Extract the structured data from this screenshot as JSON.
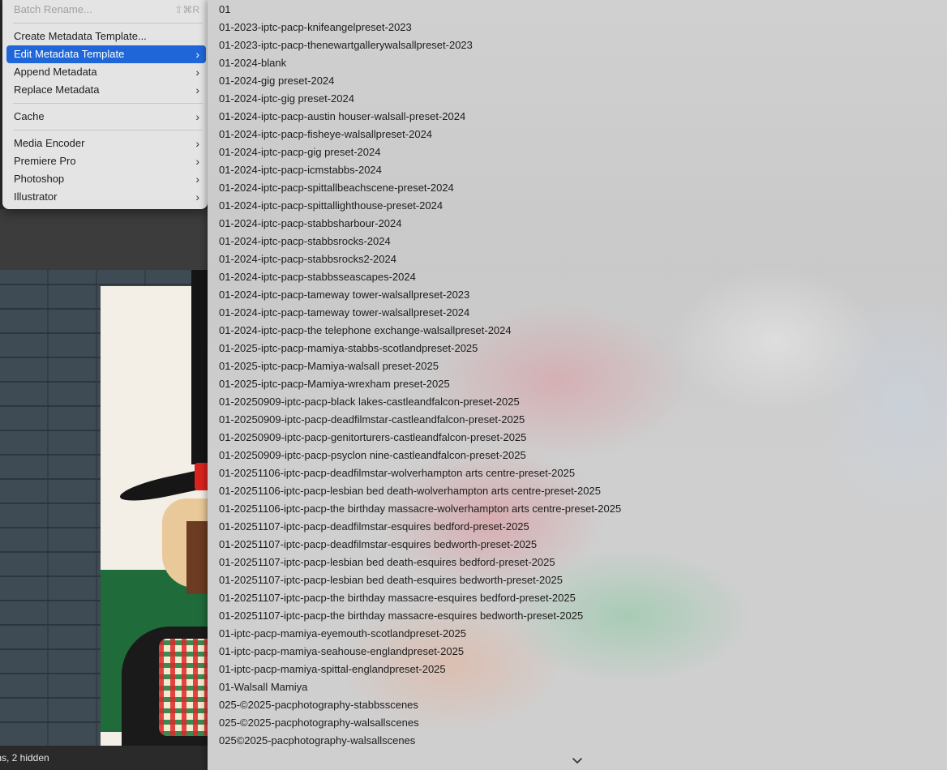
{
  "menu": {
    "batch_rename": {
      "label": "Batch Rename...",
      "shortcut": "⇧⌘R"
    },
    "items": [
      {
        "label": "Create Metadata Template...",
        "submenu": false
      },
      {
        "label": "Edit Metadata Template",
        "submenu": true,
        "selected": true
      },
      {
        "label": "Append Metadata",
        "submenu": true
      },
      {
        "label": "Replace Metadata",
        "submenu": true
      }
    ],
    "cache": {
      "label": "Cache"
    },
    "apps": [
      {
        "label": "Media Encoder"
      },
      {
        "label": "Premiere Pro"
      },
      {
        "label": "Photoshop"
      },
      {
        "label": "Illustrator"
      }
    ]
  },
  "submenu": {
    "templates": [
      "01",
      "01-2023-iptc-pacp-knifeangelpreset-2023",
      "01-2023-iptc-pacp-thenewartgallerywalsallpreset-2023",
      "01-2024-blank",
      "01-2024-gig preset-2024",
      "01-2024-iptc-gig preset-2024",
      "01-2024-iptc-pacp-austin houser-walsall-preset-2024",
      "01-2024-iptc-pacp-fisheye-walsallpreset-2024",
      "01-2024-iptc-pacp-gig preset-2024",
      "01-2024-iptc-pacp-icmstabbs-2024",
      "01-2024-iptc-pacp-spittallbeachscene-preset-2024",
      "01-2024-iptc-pacp-spittallighthouse-preset-2024",
      "01-2024-iptc-pacp-stabbsharbour-2024",
      "01-2024-iptc-pacp-stabbsrocks-2024",
      "01-2024-iptc-pacp-stabbsrocks2-2024",
      "01-2024-iptc-pacp-stabbsseascapes-2024",
      "01-2024-iptc-pacp-tameway tower-walsallpreset-2023",
      "01-2024-iptc-pacp-tameway tower-walsallpreset-2024",
      "01-2024-iptc-pacp-the telephone exchange-walsallpreset-2024",
      "01-2025-iptc-pacp-mamiya-stabbs-scotlandpreset-2025",
      "01-2025-iptc-pacp-Mamiya-walsall preset-2025",
      "01-2025-iptc-pacp-Mamiya-wrexham preset-2025",
      "01-20250909-iptc-pacp-black lakes-castleandfalcon-preset-2025",
      "01-20250909-iptc-pacp-deadfilmstar-castleandfalcon-preset-2025",
      "01-20250909-iptc-pacp-genitorturers-castleandfalcon-preset-2025",
      "01-20250909-iptc-pacp-psyclon nine-castleandfalcon-preset-2025",
      "01-20251106-iptc-pacp-deadfilmstar-wolverhampton arts centre-preset-2025",
      "01-20251106-iptc-pacp-lesbian bed death-wolverhampton arts centre-preset-2025",
      "01-20251106-iptc-pacp-the birthday massacre-wolverhampton arts centre-preset-2025",
      "01-20251107-iptc-pacp-deadfilmstar-esquires bedford-preset-2025",
      "01-20251107-iptc-pacp-deadfilmstar-esquires bedworth-preset-2025",
      "01-20251107-iptc-pacp-lesbian bed death-esquires bedford-preset-2025",
      "01-20251107-iptc-pacp-lesbian bed death-esquires bedworth-preset-2025",
      "01-20251107-iptc-pacp-the birthday massacre-esquires bedford-preset-2025",
      "01-20251107-iptc-pacp-the birthday massacre-esquires bedworth-preset-2025",
      "01-iptc-pacp-mamiya-eyemouth-scotlandpreset-2025",
      "01-iptc-pacp-mamiya-seahouse-englandpreset-2025",
      "01-iptc-pacp-mamiya-spittal-englandpreset-2025",
      "01-Walsall Mamiya",
      "025-©2025-pacphotography-stabbsscenes",
      "025-©2025-pacphotography-walsallscenes",
      "025©2025-pacphotography-walsallscenes"
    ]
  },
  "statusbar": {
    "text": "ms, 2 hidden"
  },
  "colors": {
    "selection": "#1f67d9",
    "menu_bg": "#e4e4e4"
  }
}
